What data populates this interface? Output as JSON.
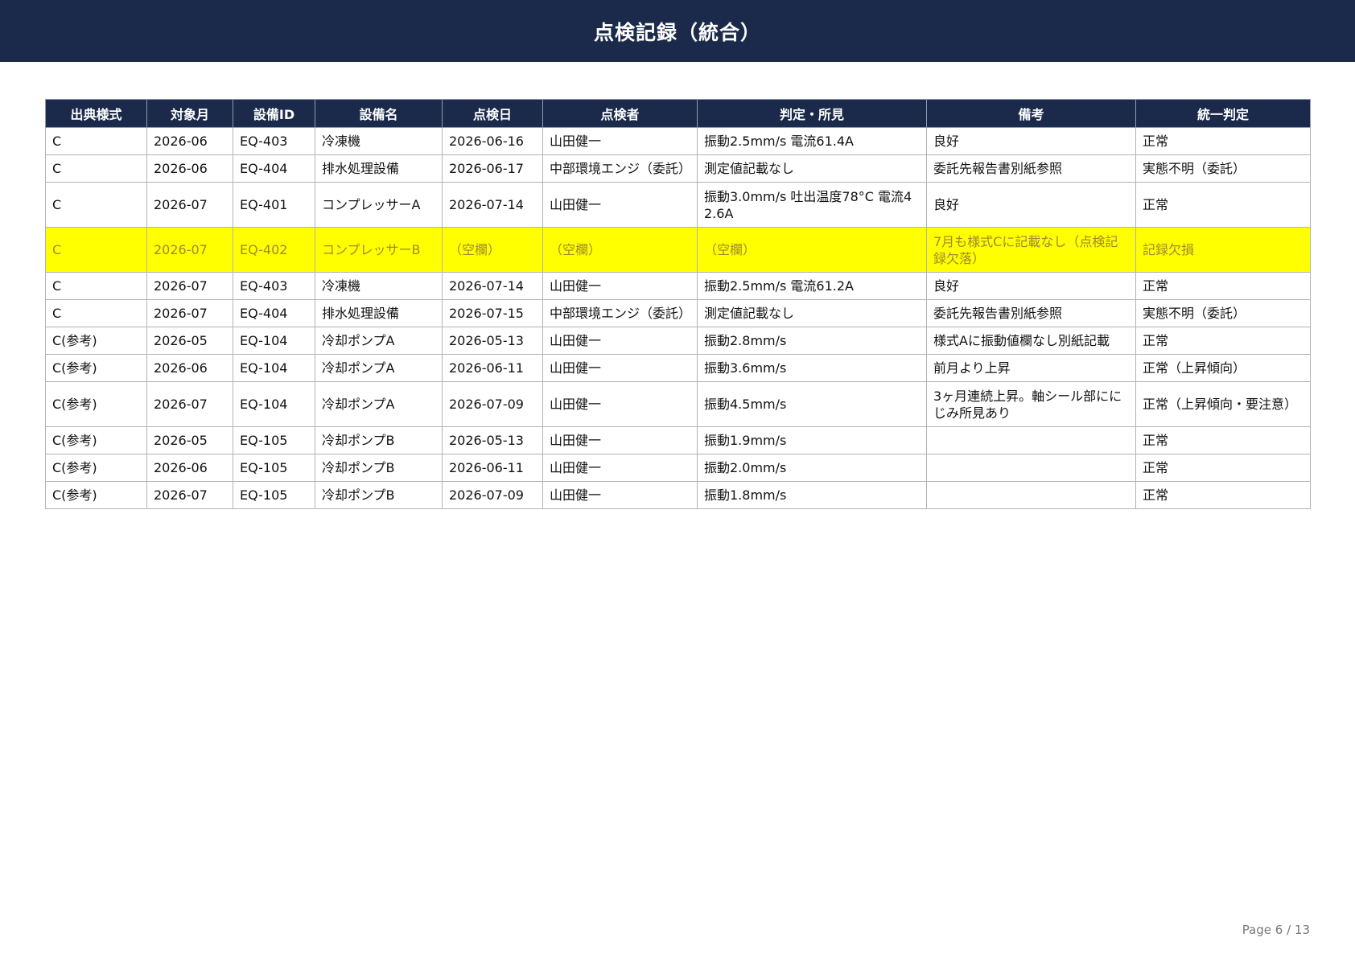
{
  "title": "点検記録（統合）",
  "table": {
    "headers": [
      "出典様式",
      "対象月",
      "設備ID",
      "設備名",
      "点検日",
      "点検者",
      "判定・所見",
      "備考",
      "統一判定"
    ],
    "rows": [
      {
        "cells": [
          "C",
          "2026-06",
          "EQ-403",
          "冷凍機",
          "2026-06-16",
          "山田健一",
          "振動2.5mm/s 電流61.4A",
          "良好",
          "正常"
        ],
        "highlight": false
      },
      {
        "cells": [
          "C",
          "2026-06",
          "EQ-404",
          "排水処理設備",
          "2026-06-17",
          "中部環境エンジ（委託）",
          "測定値記載なし",
          "委託先報告書別紙参照",
          "実態不明（委託）"
        ],
        "highlight": false
      },
      {
        "cells": [
          "C",
          "2026-07",
          "EQ-401",
          "コンプレッサーA",
          "2026-07-14",
          "山田健一",
          "振動3.0mm/s 吐出温度78°C 電流42.6A",
          "良好",
          "正常"
        ],
        "highlight": false,
        "tall": true
      },
      {
        "cells": [
          "C",
          "2026-07",
          "EQ-402",
          "コンプレッサーB",
          "（空欄）",
          "（空欄）",
          "（空欄）",
          "7月も様式Cに記載なし（点検記録欠落）",
          "記録欠損"
        ],
        "highlight": true,
        "tall": true,
        "highlight_color": "#ffff00"
      },
      {
        "cells": [
          "C",
          "2026-07",
          "EQ-403",
          "冷凍機",
          "2026-07-14",
          "山田健一",
          "振動2.5mm/s 電流61.2A",
          "良好",
          "正常"
        ],
        "highlight": false
      },
      {
        "cells": [
          "C",
          "2026-07",
          "EQ-404",
          "排水処理設備",
          "2026-07-15",
          "中部環境エンジ（委託）",
          "測定値記載なし",
          "委託先報告書別紙参照",
          "実態不明（委託）"
        ],
        "highlight": false
      },
      {
        "cells": [
          "C(参考)",
          "2026-05",
          "EQ-104",
          "冷却ポンプA",
          "2026-05-13",
          "山田健一",
          "振動2.8mm/s",
          "様式Aに振動値欄なし別紙記載",
          "正常"
        ],
        "highlight": false
      },
      {
        "cells": [
          "C(参考)",
          "2026-06",
          "EQ-104",
          "冷却ポンプA",
          "2026-06-11",
          "山田健一",
          "振動3.6mm/s",
          "前月より上昇",
          "正常（上昇傾向）"
        ],
        "highlight": false
      },
      {
        "cells": [
          "C(参考)",
          "2026-07",
          "EQ-104",
          "冷却ポンプA",
          "2026-07-09",
          "山田健一",
          "振動4.5mm/s",
          "3ヶ月連続上昇。軸シール部ににじみ所見あり",
          "正常（上昇傾向・要注意）"
        ],
        "highlight": false,
        "tall": true
      },
      {
        "cells": [
          "C(参考)",
          "2026-05",
          "EQ-105",
          "冷却ポンプB",
          "2026-05-13",
          "山田健一",
          "振動1.9mm/s",
          "",
          "正常"
        ],
        "highlight": false
      },
      {
        "cells": [
          "C(参考)",
          "2026-06",
          "EQ-105",
          "冷却ポンプB",
          "2026-06-11",
          "山田健一",
          "振動2.0mm/s",
          "",
          "正常"
        ],
        "highlight": false
      },
      {
        "cells": [
          "C(参考)",
          "2026-07",
          "EQ-105",
          "冷却ポンプB",
          "2026-07-09",
          "山田健一",
          "振動1.8mm/s",
          "",
          "正常"
        ],
        "highlight": false
      }
    ]
  },
  "footer": {
    "page_label": "Page 6 / 13"
  },
  "colors": {
    "banner": "#1b2a4a",
    "highlight": "#ffff00",
    "highlight_text": "#a08a2a"
  }
}
